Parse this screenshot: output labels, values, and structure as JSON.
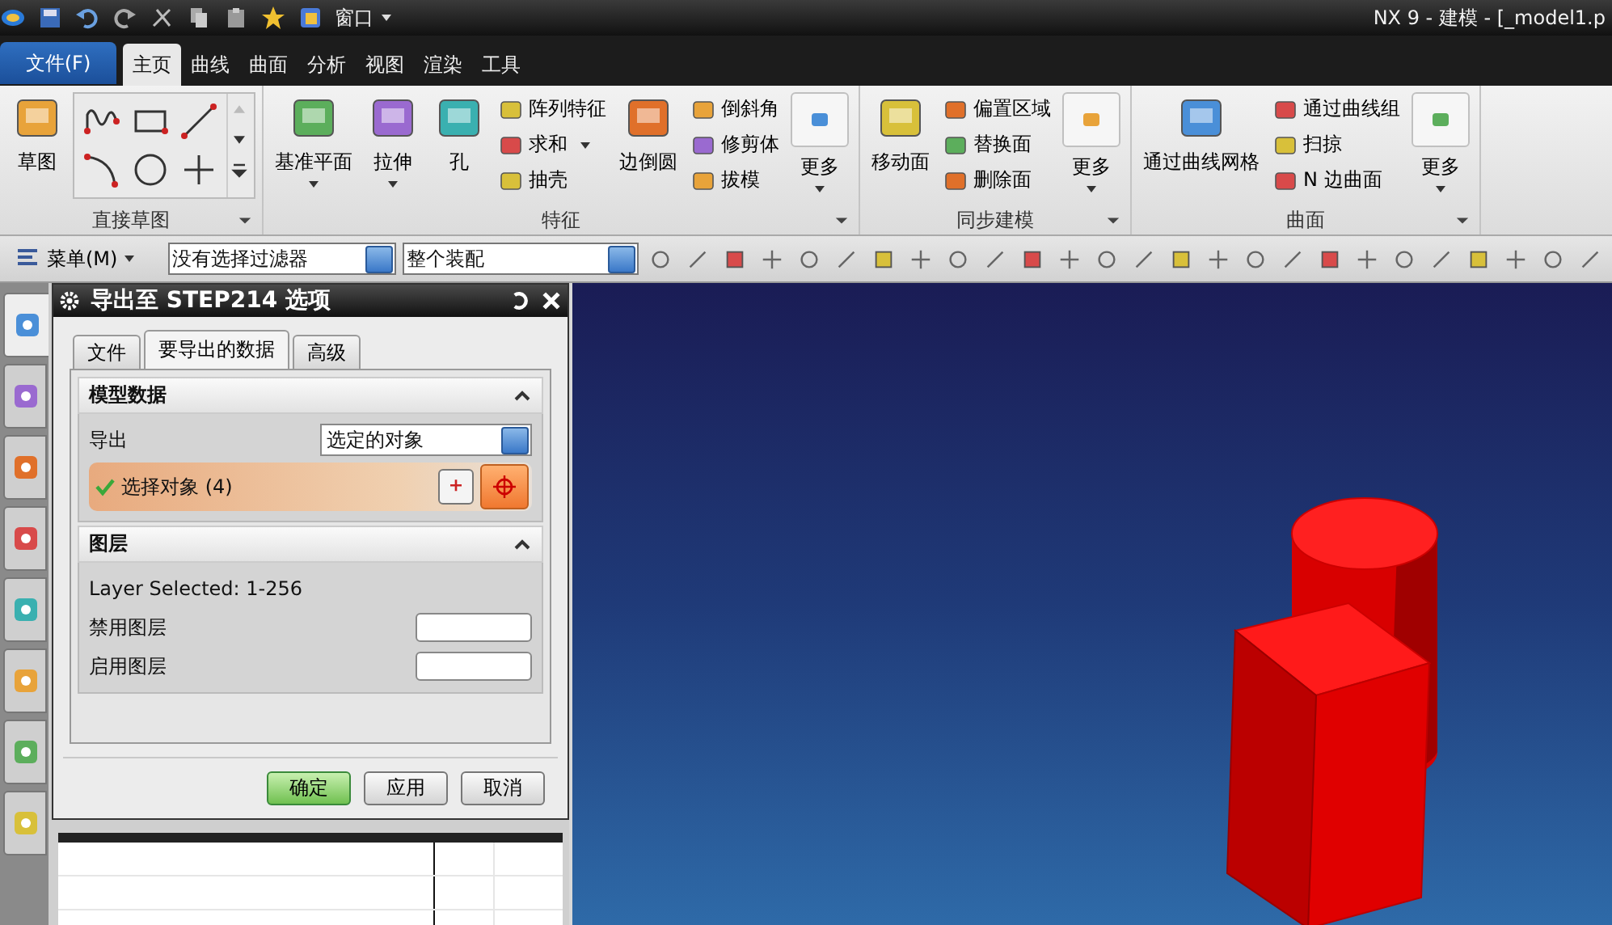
{
  "window": {
    "title": "NX 9 - 建模 - [_model1.p",
    "window_menu": "窗口"
  },
  "file_button": "文件(F)",
  "tabs": [
    {
      "label": "主页",
      "selected": true
    },
    {
      "label": "曲线",
      "selected": false
    },
    {
      "label": "曲面",
      "selected": false
    },
    {
      "label": "分析",
      "selected": false
    },
    {
      "label": "视图",
      "selected": false
    },
    {
      "label": "渲染",
      "selected": false
    },
    {
      "label": "工具",
      "selected": false
    }
  ],
  "ribbon": [
    {
      "title": "直接草图",
      "items": [
        {
          "kind": "large",
          "label": "草图",
          "dropdown": false
        },
        {
          "kind": "gallery"
        }
      ]
    },
    {
      "title": "特征",
      "items": [
        {
          "kind": "large",
          "label": "基准平面",
          "dropdown": true
        },
        {
          "kind": "large",
          "label": "拉伸",
          "dropdown": true
        },
        {
          "kind": "large",
          "label": "孔",
          "dropdown": false
        },
        {
          "kind": "stack",
          "items": [
            {
              "label": "阵列特征",
              "dropdown": false
            },
            {
              "label": "求和",
              "dropdown": true
            },
            {
              "label": "抽壳",
              "dropdown": false
            }
          ]
        },
        {
          "kind": "large",
          "label": "边倒圆",
          "dropdown": false
        },
        {
          "kind": "stack",
          "items": [
            {
              "label": "倒斜角",
              "dropdown": false
            },
            {
              "label": "修剪体",
              "dropdown": false
            },
            {
              "label": "拔模",
              "dropdown": false
            }
          ]
        },
        {
          "kind": "more",
          "label": "更多"
        }
      ]
    },
    {
      "title": "同步建模",
      "items": [
        {
          "kind": "large",
          "label": "移动面",
          "dropdown": false
        },
        {
          "kind": "stack",
          "items": [
            {
              "label": "偏置区域",
              "dropdown": false
            },
            {
              "label": "替换面",
              "dropdown": false
            },
            {
              "label": "删除面",
              "dropdown": false
            }
          ]
        },
        {
          "kind": "more",
          "label": "更多"
        }
      ]
    },
    {
      "title": "曲面",
      "items": [
        {
          "kind": "large",
          "label": "通过曲线网格",
          "dropdown": false
        },
        {
          "kind": "stack",
          "items": [
            {
              "label": "通过曲线组",
              "dropdown": false
            },
            {
              "label": "扫掠",
              "dropdown": false
            },
            {
              "label": "N 边曲面",
              "dropdown": false
            }
          ]
        },
        {
          "kind": "more",
          "label": "更多"
        }
      ]
    }
  ],
  "toolbar": {
    "menu": "菜单(M)",
    "filter": "没有选择过滤器",
    "scope": "整个装配"
  },
  "resource_tabs": [
    {
      "selected": true
    },
    {
      "selected": false
    },
    {
      "selected": false
    },
    {
      "selected": false
    },
    {
      "selected": false
    },
    {
      "selected": false
    },
    {
      "selected": false
    },
    {
      "selected": false
    }
  ],
  "dialog": {
    "title": "导出至 STEP214 选项",
    "tabs": [
      {
        "label": "文件",
        "selected": false
      },
      {
        "label": "要导出的数据",
        "selected": true
      },
      {
        "label": "高级",
        "selected": false
      }
    ],
    "sections": [
      {
        "title": "模型数据",
        "expanded": true,
        "rows": [
          {
            "kind": "select",
            "label": "导出",
            "value": "选定的对象"
          },
          {
            "kind": "selection",
            "label": "选择对象 (4)",
            "complete": true,
            "active": true
          }
        ]
      },
      {
        "title": "图层",
        "expanded": true,
        "rows": [
          {
            "kind": "text",
            "label": "Layer Selected: 1-256"
          },
          {
            "kind": "input",
            "label": "禁用图层"
          },
          {
            "kind": "input",
            "label": "启用图层"
          }
        ]
      }
    ],
    "buttons": [
      {
        "label": "确定",
        "default": true
      },
      {
        "label": "应用",
        "default": false
      },
      {
        "label": "取消",
        "default": false
      }
    ]
  }
}
